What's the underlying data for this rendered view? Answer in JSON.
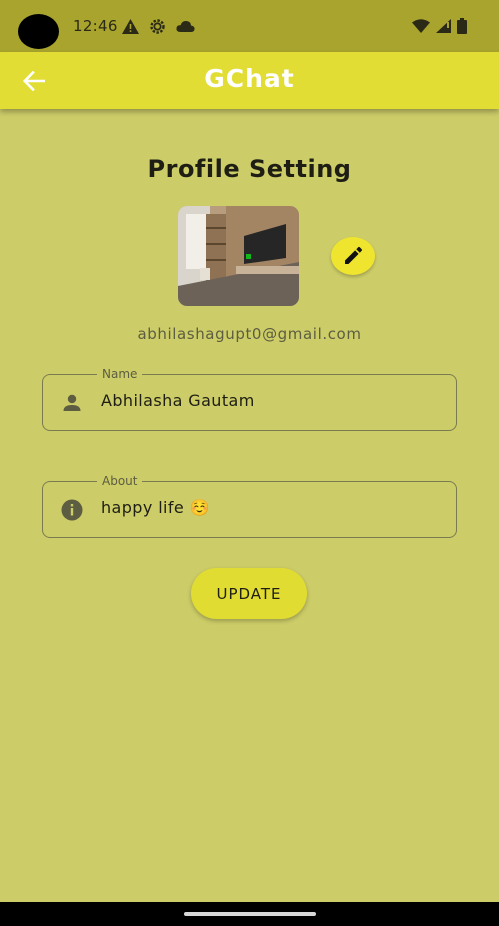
{
  "status_bar": {
    "time": "12:46",
    "left_icons": [
      "warning-icon",
      "settings-icon",
      "cloud-icon"
    ],
    "right_icons": [
      "wifi-icon",
      "signal-icon",
      "battery-icon"
    ]
  },
  "app_bar": {
    "title": "GChat",
    "back_icon": "arrow-left-icon"
  },
  "profile": {
    "heading": "Profile Setting",
    "email": "abhilashagupt0@gmail.com",
    "edit_icon": "pencil-icon"
  },
  "form": {
    "name": {
      "label": "Name",
      "value": "Abhilasha Gautam",
      "icon": "person-icon"
    },
    "about": {
      "label": "About",
      "value": "happy life ☺️",
      "icon": "info-icon"
    }
  },
  "update_button": {
    "label": "UPDATE"
  },
  "colors": {
    "background": "#cccc68",
    "status_bar": "#a9a42e",
    "app_bar": "#e1dd35",
    "accent": "#f0e52e"
  }
}
